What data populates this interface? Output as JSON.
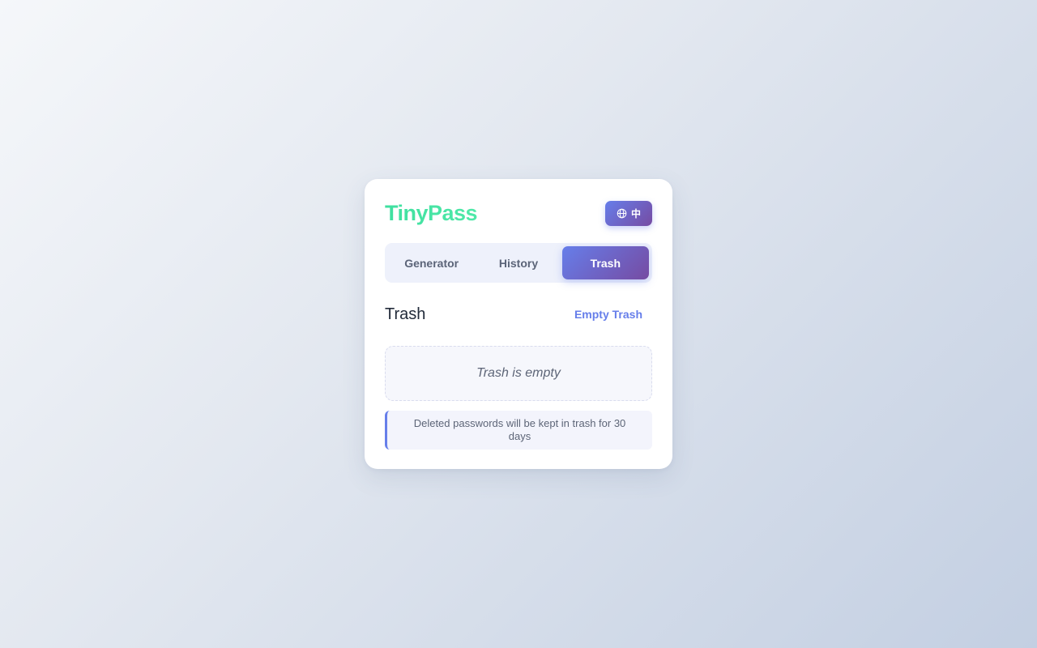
{
  "app": {
    "logo": "TinyPass",
    "language_button": {
      "icon": "globe-icon",
      "label": "中"
    }
  },
  "tabs": [
    {
      "label": "Generator",
      "active": false
    },
    {
      "label": "History",
      "active": false
    },
    {
      "label": "Trash",
      "active": true
    }
  ],
  "trash": {
    "title": "Trash",
    "empty_button_label": "Empty Trash",
    "empty_message": "Trash is empty",
    "retention_note": "Deleted passwords will be kept in trash for 30 days"
  },
  "colors": {
    "logo": "#42e09b",
    "accent_start": "#667eea",
    "accent_end": "#764ba2",
    "text_dark": "#222b3a",
    "text_muted": "#5d6577"
  }
}
